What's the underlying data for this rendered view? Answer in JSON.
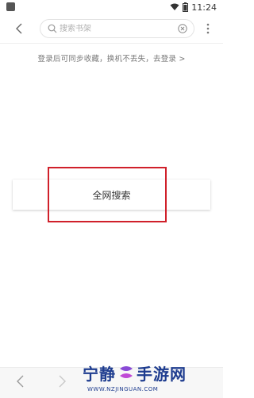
{
  "status_bar": {
    "time": "11:24"
  },
  "search": {
    "placeholder": "搜索书架",
    "value": ""
  },
  "login_hint": "登录后可同步收藏，换机不丢失，去登录 >",
  "search_web_button": "全网搜索",
  "watermark": {
    "name_part1": "宁静",
    "name_part2": "手游网",
    "domain": "WWW.NZJINGUAN.COM"
  },
  "colors": {
    "accent_red": "#d0202a",
    "watermark_blue": "#1e3c8f",
    "watermark_purple": "#8a4ad6"
  }
}
